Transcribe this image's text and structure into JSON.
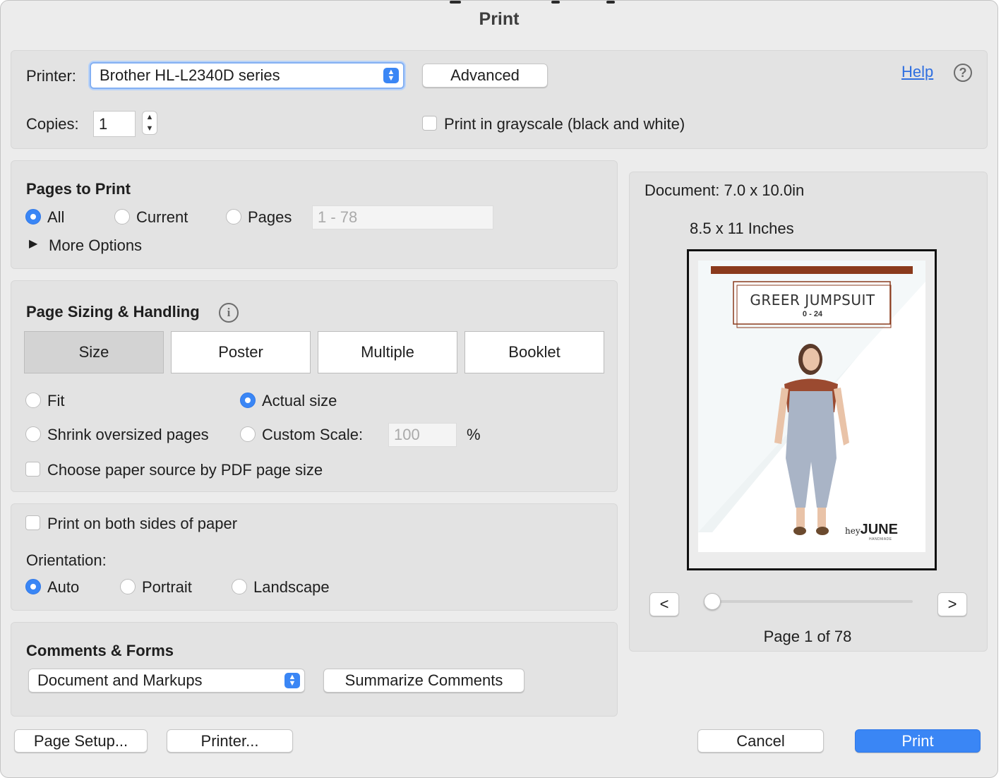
{
  "window": {
    "title": "Print"
  },
  "printer": {
    "label": "Printer:",
    "selected": "Brother HL-L2340D series",
    "advanced_label": "Advanced",
    "help_label": "Help"
  },
  "copies": {
    "label": "Copies:",
    "value": "1"
  },
  "grayscale": {
    "label": "Print in grayscale (black and white)",
    "checked": false
  },
  "pages_to_print": {
    "heading": "Pages to Print",
    "all_label": "All",
    "current_label": "Current",
    "pages_label": "Pages",
    "range_placeholder": "1 - 78",
    "selected": "All",
    "more_options_label": "More Options"
  },
  "page_sizing": {
    "heading": "Page Sizing & Handling",
    "tabs": [
      "Size",
      "Poster",
      "Multiple",
      "Booklet"
    ],
    "active_tab": "Size",
    "fit_label": "Fit",
    "actual_size_label": "Actual size",
    "shrink_label": "Shrink oversized pages",
    "custom_scale_label": "Custom Scale:",
    "custom_scale_value": "100",
    "percent_label": "%",
    "selected": "Actual size",
    "paper_source_label": "Choose paper source by PDF page size"
  },
  "duplex": {
    "label": "Print on both sides of paper",
    "checked": false
  },
  "orientation": {
    "label": "Orientation:",
    "auto_label": "Auto",
    "portrait_label": "Portrait",
    "landscape_label": "Landscape",
    "selected": "Auto"
  },
  "comments_forms": {
    "heading": "Comments & Forms",
    "selected": "Document and Markups",
    "summarize_label": "Summarize Comments"
  },
  "preview": {
    "document_label": "Document: 7.0 x 10.0in",
    "paper_label": "8.5 x 11 Inches",
    "doc_title": "GREER JUMPSUIT",
    "doc_sizes": "0 - 24",
    "brand_prefix": "hey",
    "brand_name": "JUNE",
    "brand_sub": "HANDMADE",
    "prev_label": "<",
    "next_label": ">",
    "page_indicator": "Page 1 of 78",
    "current_page": 1,
    "total_pages": 78
  },
  "footer": {
    "page_setup_label": "Page Setup...",
    "printer_label": "Printer...",
    "cancel_label": "Cancel",
    "print_label": "Print"
  },
  "colors": {
    "accent": "#3a86f5",
    "brand_rust": "#8a3a1c"
  }
}
